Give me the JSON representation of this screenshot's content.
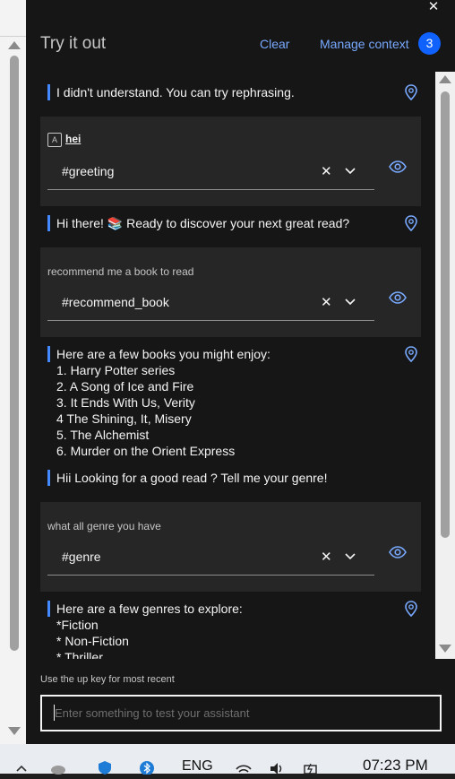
{
  "panel": {
    "title": "Try it out",
    "clear_label": "Clear",
    "manage_label": "Manage context",
    "badge_count": "3"
  },
  "conversation": {
    "msg1": "I didn't understand. You can try rephrasing.",
    "card1": {
      "utterance": "hei",
      "intent": "#greeting"
    },
    "msg2": "Hi there! 📚 Ready to discover your next great read?",
    "card2": {
      "utterance": "recommend me a book to read",
      "intent": "#recommend_book"
    },
    "msg3": {
      "lines": [
        "Here are a few books you might enjoy:",
        "1. Harry Potter series",
        "2. A Song of Ice and Fire",
        "3. It Ends With Us, Verity",
        "4 The Shining, It, Misery",
        "5. The Alchemist",
        "6. Murder on the Orient Express"
      ]
    },
    "msg4": "Hii Looking for a good read ? Tell me your genre!",
    "card3": {
      "utterance": "what all genre you have",
      "intent": "#genre"
    },
    "msg5": {
      "lines": [
        "Here are a few genres to explore:",
        "*Fiction",
        "* Non-Fiction",
        "* Thriller"
      ]
    }
  },
  "input": {
    "hint": "Use the up key for most recent",
    "placeholder": "Enter something to test your assistant"
  },
  "taskbar": {
    "lang": "ENG",
    "time": "07:23 PM"
  },
  "colors": {
    "accent": "#4589ff",
    "link": "#78a9ff",
    "badge": "#0f62fe",
    "panel_bg": "#161616",
    "card_bg": "#262626"
  },
  "icons": [
    "close-icon",
    "pin-icon",
    "eye-icon",
    "chevron-down-icon",
    "clear-x-icon",
    "scroll-up-icon",
    "scroll-down-icon"
  ]
}
